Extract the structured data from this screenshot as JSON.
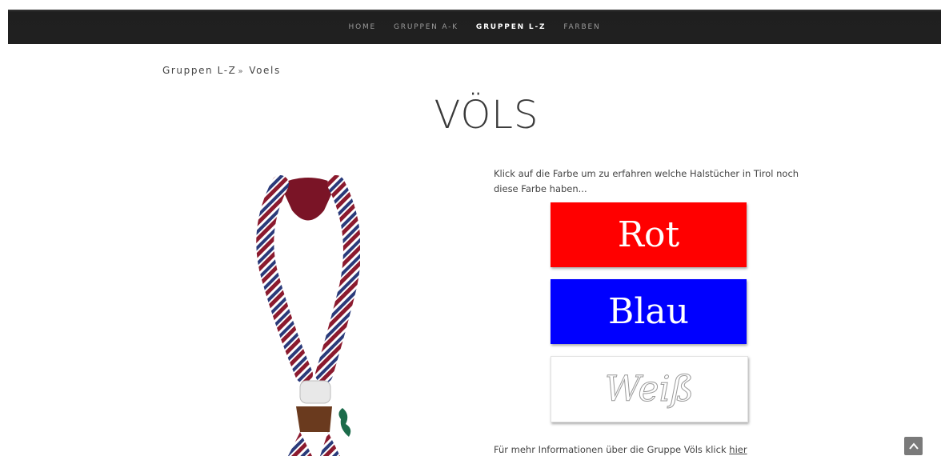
{
  "nav": {
    "items": [
      {
        "label": "HOME",
        "active": false
      },
      {
        "label": "GRUPPEN A-K",
        "active": false
      },
      {
        "label": "GRUPPEN L-Z",
        "active": true
      },
      {
        "label": "FARBEN",
        "active": false
      }
    ]
  },
  "breadcrumb": {
    "parent": "Gruppen L-Z",
    "separator": "»",
    "current": "Voels"
  },
  "page_title": "VÖLS",
  "intro_text": "Klick auf die Farbe um zu erfahren welche Halstücher in Tirol noch diese Farbe haben...",
  "colors": {
    "rot": {
      "label": "Rot",
      "color": "#ff0000"
    },
    "blau": {
      "label": "Blau",
      "color": "#0000ff"
    },
    "weiss": {
      "label": "Weiß",
      "color": "#ffffff"
    }
  },
  "more_info": {
    "text": "Für mehr Informationen über die Gruppe Völs klick ",
    "link": "hier"
  },
  "scroll_top_icon": "chevron-up-icon"
}
